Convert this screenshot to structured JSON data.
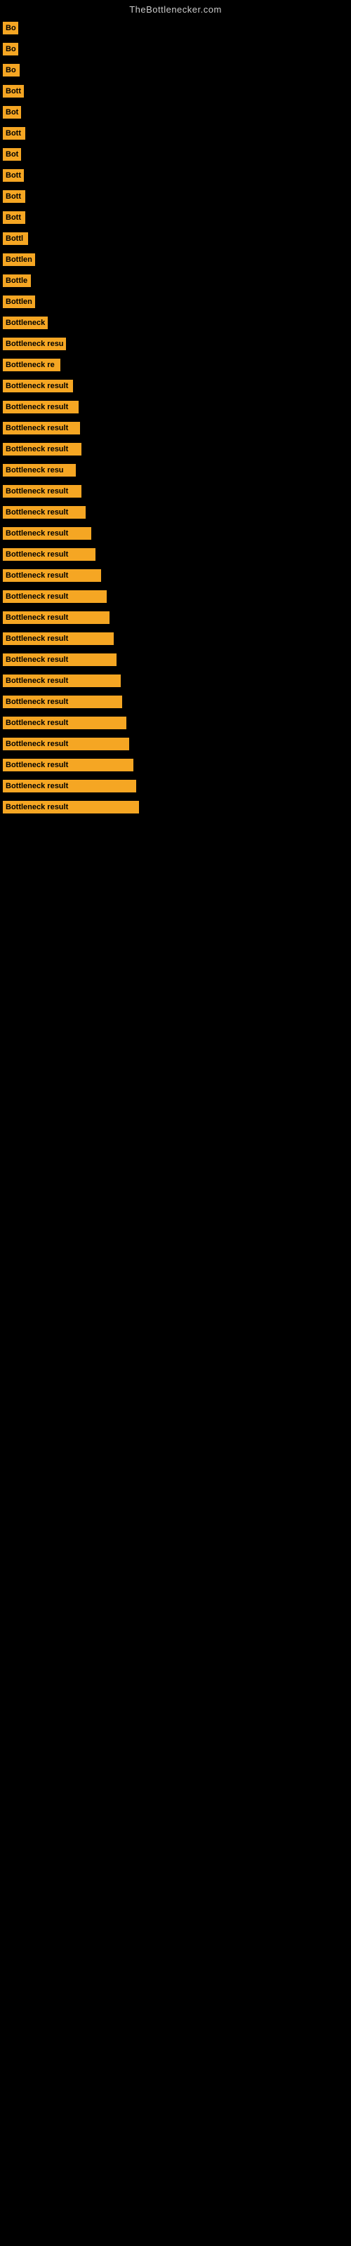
{
  "site": {
    "title": "TheBottlenecker.com"
  },
  "bars": [
    {
      "label": "Bo",
      "width": 22
    },
    {
      "label": "Bo",
      "width": 22
    },
    {
      "label": "Bo",
      "width": 24
    },
    {
      "label": "Bott",
      "width": 30
    },
    {
      "label": "Bot",
      "width": 26
    },
    {
      "label": "Bott",
      "width": 32
    },
    {
      "label": "Bot",
      "width": 26
    },
    {
      "label": "Bott",
      "width": 30
    },
    {
      "label": "Bott",
      "width": 32
    },
    {
      "label": "Bott",
      "width": 32
    },
    {
      "label": "Bottl",
      "width": 36
    },
    {
      "label": "Bottlen",
      "width": 46
    },
    {
      "label": "Bottle",
      "width": 40
    },
    {
      "label": "Bottlen",
      "width": 46
    },
    {
      "label": "Bottleneck",
      "width": 64
    },
    {
      "label": "Bottleneck resu",
      "width": 90
    },
    {
      "label": "Bottleneck re",
      "width": 82
    },
    {
      "label": "Bottleneck result",
      "width": 100
    },
    {
      "label": "Bottleneck result",
      "width": 108
    },
    {
      "label": "Bottleneck result",
      "width": 110
    },
    {
      "label": "Bottleneck result",
      "width": 112
    },
    {
      "label": "Bottleneck resu",
      "width": 104
    },
    {
      "label": "Bottleneck result",
      "width": 112
    },
    {
      "label": "Bottleneck result",
      "width": 118
    },
    {
      "label": "Bottleneck result",
      "width": 126
    },
    {
      "label": "Bottleneck result",
      "width": 132
    },
    {
      "label": "Bottleneck result",
      "width": 140
    },
    {
      "label": "Bottleneck result",
      "width": 148
    },
    {
      "label": "Bottleneck result",
      "width": 152
    },
    {
      "label": "Bottleneck result",
      "width": 158
    },
    {
      "label": "Bottleneck result",
      "width": 162
    },
    {
      "label": "Bottleneck result",
      "width": 168
    },
    {
      "label": "Bottleneck result",
      "width": 170
    },
    {
      "label": "Bottleneck result",
      "width": 176
    },
    {
      "label": "Bottleneck result",
      "width": 180
    },
    {
      "label": "Bottleneck result",
      "width": 186
    },
    {
      "label": "Bottleneck result",
      "width": 190
    },
    {
      "label": "Bottleneck result",
      "width": 194
    }
  ]
}
